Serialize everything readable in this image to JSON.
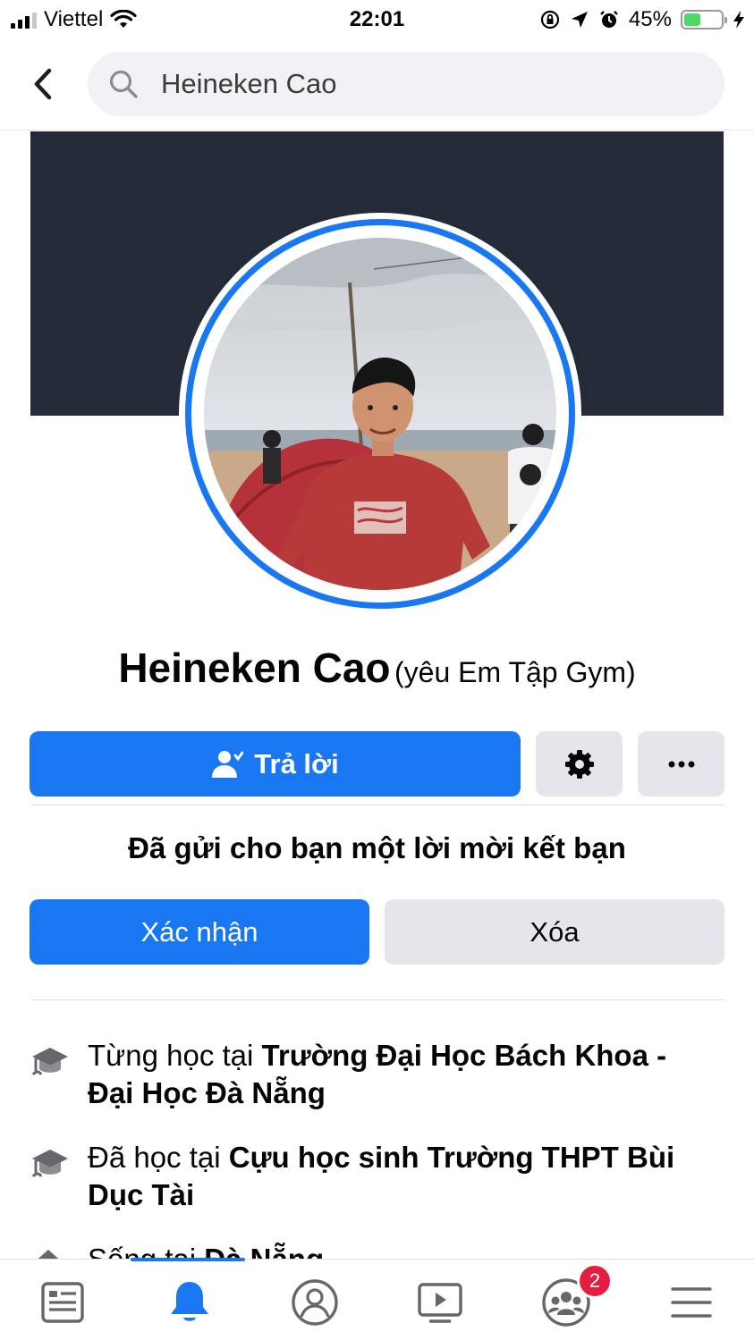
{
  "status_bar": {
    "carrier": "Viettel",
    "time": "22:01",
    "battery_percent": "45%",
    "battery_level": 0.45,
    "battery_color": "#4cd964"
  },
  "header": {
    "search_value": "Heineken Cao",
    "icons": [
      "chevron-left-icon",
      "search-icon"
    ]
  },
  "profile": {
    "name": "Heineken Cao",
    "alternate_name": "(yêu Em Tập Gym)",
    "cover_color": "#242a38",
    "ring_color": "#1a77f2"
  },
  "actions": {
    "reply_label": "Trả lời",
    "settings_icon": "gear-icon",
    "more_icon": "ellipsis-icon"
  },
  "friend_request": {
    "message": "Đã gửi cho bạn một lời mời kết bạn",
    "confirm_label": "Xác nhận",
    "delete_label": "Xóa"
  },
  "about": [
    {
      "prefix": "Từng học tại",
      "value": "Trường Đại Học Bách Khoa - Đại Học Đà Nẵng",
      "icon": "graduation-cap-icon"
    },
    {
      "prefix": "Đã học tại",
      "value": "Cựu học sinh Trường THPT Bùi Dục Tài",
      "icon": "graduation-cap-icon"
    },
    {
      "prefix": "Sống tại",
      "value": "Đà Nẵng",
      "icon": "home-icon"
    }
  ],
  "tab_bar": {
    "tabs": [
      "news-feed-icon",
      "notifications-bell-icon",
      "profile-icon",
      "watch-video-icon",
      "groups-icon",
      "menu-icon"
    ],
    "active_index": 1,
    "groups_badge": "2",
    "accent_color": "#1a77f2",
    "badge_color": "#e41e3f"
  }
}
